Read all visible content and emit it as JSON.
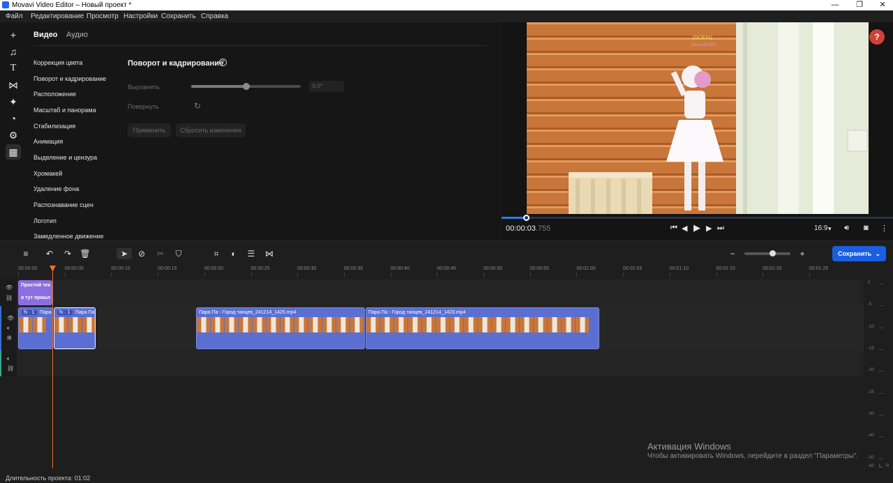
{
  "window": {
    "title": "Movavi Video Editor – Новый проект *",
    "controls": [
      "—",
      "❐",
      "✕"
    ]
  },
  "menu": [
    "Файл",
    "Редактирование",
    "Просмотр",
    "Настройки",
    "Сохранить",
    "Справка"
  ],
  "left_rail": {
    "icons": [
      "add-icon",
      "music-icon",
      "text-icon",
      "transitions-icon",
      "effects-icon",
      "stickers-icon",
      "tools-icon",
      "more-tools-icon"
    ]
  },
  "panel": {
    "tabs": [
      {
        "label": "Видео",
        "active": true
      },
      {
        "label": "Аудио",
        "active": false
      }
    ],
    "categories": [
      "Коррекция цвета",
      "Поворот и кадрирование",
      "Расположение",
      "Масштаб и панорама",
      "Стабилизация",
      "Анимация",
      "Выделение и цензура",
      "Хромакей",
      "Удаление фона",
      "Распознавание сцен",
      "Логотип",
      "Замедленное движение"
    ],
    "section": {
      "title": "Поворот и кадрирование",
      "align_label": "Выровнять",
      "align_value": "0,0°",
      "align_level": 0.5,
      "rotate_label": "Повернуть",
      "apply_label": "Применить",
      "reset_label": "Сбросить изменения"
    }
  },
  "preview": {
    "overlay_text_1": "[ОСЕТА]",
    "overlay_text_2": "Dance2VIEO",
    "timecode_main": "00:00:03",
    "timecode_ms": ".755",
    "progress": 0.063,
    "aspect_ratio": "16:9",
    "help_label": "?"
  },
  "timeline": {
    "save_label": "Сохранить",
    "zoom_level": 0.6,
    "ruler": [
      "00:00:00",
      "00:00:05",
      "00:00:10",
      "00:00:15",
      "00:00:20",
      "00:00:25",
      "00:00:30",
      "00:00:35",
      "00:00:40",
      "00:00:45",
      "00:00:50",
      "00:00:55",
      "00:01:00",
      "00:01:05",
      "00:01:10",
      "00:01:15",
      "00:01:20",
      "00:01:25"
    ],
    "title_clip": {
      "line1": "Простой тек",
      "line2": "я тут пришл"
    },
    "video_clips": [
      {
        "fx": "fx · 1",
        "name": "Пара"
      },
      {
        "fx": "fx · 1",
        "name": "Пара Па"
      },
      {
        "fx": "",
        "name": "Пара Па - Город танцев_241214_1425.mp4"
      },
      {
        "fx": "",
        "name": "Пара Па - Город танцев_241214_1423.mp4"
      }
    ],
    "vu_labels": [
      "0",
      "-5",
      "-10",
      "-15",
      "-20",
      "-25",
      "-30",
      "-40",
      "-50",
      "-60",
      "L",
      "R"
    ],
    "duration_label": "Длительность проекта: 01:02"
  },
  "watermark": {
    "line1": "Активация Windows",
    "line2": "Чтобы активировать Windows, перейдите в раздел \"Параметры\"."
  }
}
